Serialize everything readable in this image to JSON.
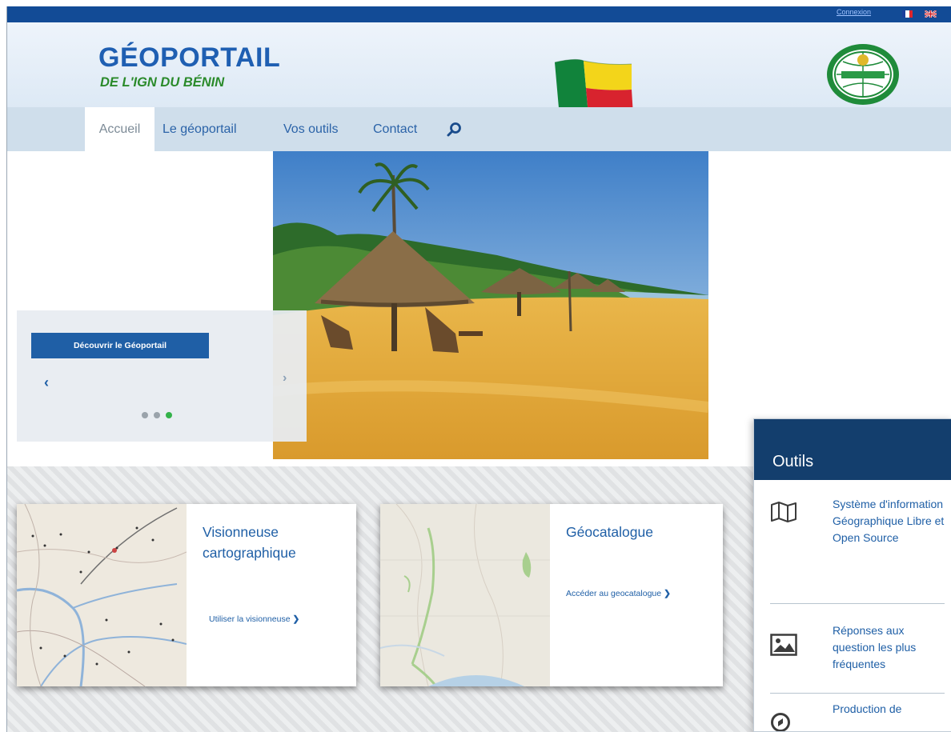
{
  "topbar": {
    "login_label": "Connexion",
    "lang_fr": "FR",
    "lang_en": "EN"
  },
  "header": {
    "title": "GÉOPORTAIL",
    "subtitle": "DE L'IGN DU BÉNIN"
  },
  "nav": {
    "items": [
      {
        "label": "Accueil"
      },
      {
        "label": "Le géoportail"
      },
      {
        "label": "Vos outils"
      },
      {
        "label": "Contact"
      }
    ],
    "search_icon": "search-icon"
  },
  "hero": {
    "button_label": "Découvrir le Géoportail",
    "prev_label": "‹",
    "next_label": "›",
    "slide_count": 3,
    "active_slide": 3
  },
  "cards": [
    {
      "title_line1": "Visionneuse",
      "title_line2": "cartographique",
      "link_label": "Utiliser la visionneuse",
      "chevron": "❯"
    },
    {
      "title_line1": "Géocatalogue",
      "title_line2": "",
      "link_label": "Accéder au geocatalogue",
      "chevron": "❯"
    }
  ],
  "tools": {
    "heading": "Outils",
    "items": [
      {
        "label": "Système d'information Géographique Libre et Open Source",
        "icon": "map-icon"
      },
      {
        "label": "Réponses aux question les plus fréquentes",
        "icon": "image-icon"
      },
      {
        "label": "Production de",
        "icon": "compass-icon"
      }
    ]
  },
  "colors": {
    "brand_blue": "#1f5fa6",
    "topbar": "#124b96",
    "nav_bg": "#cfdeeb",
    "accent_green": "#34b24a",
    "tools_head": "#133e6d"
  }
}
